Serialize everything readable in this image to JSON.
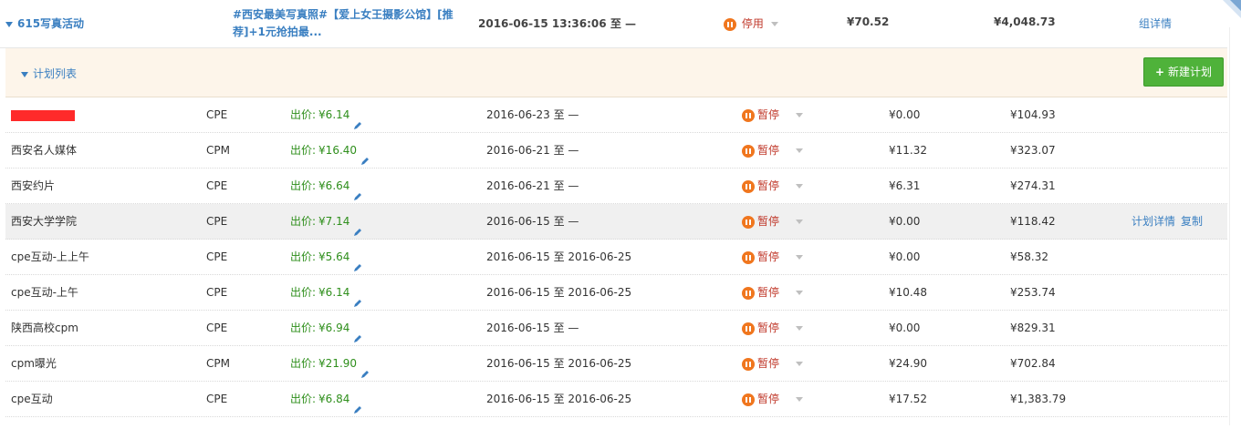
{
  "group": {
    "name": "615写真活动",
    "title": "#西安最美写真照#【爱上女王摄影公馆】[推荐]+1元抢拍最...",
    "time_start": "2016-06-15 13:36:06",
    "time_sep": "至",
    "time_end": "—",
    "status": "停用",
    "amount1": "¥70.52",
    "amount2": "¥4,048.73",
    "detail_link": "组详情"
  },
  "plan_list": {
    "label": "计划列表",
    "new_button": "新建计划",
    "new_button_icon": "+"
  },
  "rows": [
    {
      "name": "",
      "type": "CPE",
      "bid_label": "出价:",
      "bid": "¥6.14",
      "start": "2016-06-23",
      "sep": "至",
      "end": "—",
      "status": "暂停",
      "cost": "¥0.00",
      "total": "¥104.93",
      "redacted": true
    },
    {
      "name": "西安名人媒体",
      "type": "CPM",
      "bid_label": "出价:",
      "bid": "¥16.40",
      "start": "2016-06-21",
      "sep": "至",
      "end": "—",
      "status": "暂停",
      "cost": "¥11.32",
      "total": "¥323.07"
    },
    {
      "name": "西安约片",
      "type": "CPE",
      "bid_label": "出价:",
      "bid": "¥6.64",
      "start": "2016-06-21",
      "sep": "至",
      "end": "—",
      "status": "暂停",
      "cost": "¥6.31",
      "total": "¥274.31"
    },
    {
      "name": "西安大学学院",
      "type": "CPE",
      "bid_label": "出价:",
      "bid": "¥7.14",
      "start": "2016-06-15",
      "sep": "至",
      "end": "—",
      "status": "暂停",
      "cost": "¥0.00",
      "total": "¥118.42",
      "detail": "计划详情",
      "copy": "复制",
      "highlight": true
    },
    {
      "name": "cpe互动-上上午",
      "type": "CPE",
      "bid_label": "出价:",
      "bid": "¥5.64",
      "start": "2016-06-15",
      "sep": "至",
      "end": "2016-06-25",
      "status": "暂停",
      "cost": "¥0.00",
      "total": "¥58.32"
    },
    {
      "name": "cpe互动-上午",
      "type": "CPE",
      "bid_label": "出价:",
      "bid": "¥6.14",
      "start": "2016-06-15",
      "sep": "至",
      "end": "2016-06-25",
      "status": "暂停",
      "cost": "¥10.48",
      "total": "¥253.74"
    },
    {
      "name": "陕西高校cpm",
      "type": "CPE",
      "bid_label": "出价:",
      "bid": "¥6.94",
      "start": "2016-06-15",
      "sep": "至",
      "end": "—",
      "status": "暂停",
      "cost": "¥0.00",
      "total": "¥829.31"
    },
    {
      "name": "cpm曝光",
      "type": "CPM",
      "bid_label": "出价:",
      "bid": "¥21.90",
      "start": "2016-06-15",
      "sep": "至",
      "end": "2016-06-25",
      "status": "暂停",
      "cost": "¥24.90",
      "total": "¥702.84"
    },
    {
      "name": "cpe互动",
      "type": "CPE",
      "bid_label": "出价:",
      "bid": "¥6.84",
      "start": "2016-06-15",
      "sep": "至",
      "end": "2016-06-25",
      "status": "暂停",
      "cost": "¥17.52",
      "total": "¥1,383.79"
    }
  ],
  "colors": {
    "accent": "#3a7fc1",
    "pause": "#f0761e",
    "bid": "#2f8f1c",
    "status_text": "#c0392b",
    "new_button": "#4fb23a",
    "plan_bar": "#fdf5ea",
    "row_highlight": "#f0f0f0"
  }
}
